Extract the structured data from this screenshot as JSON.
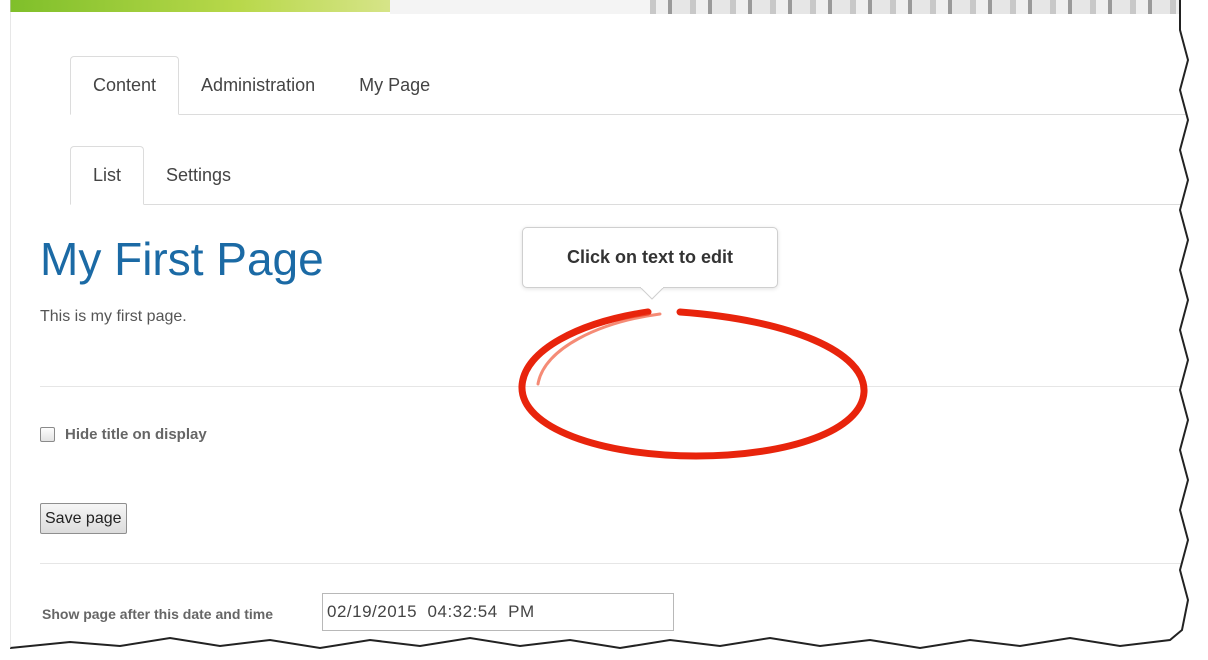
{
  "tabs_primary": [
    {
      "label": "Content",
      "active": true
    },
    {
      "label": "Administration",
      "active": false
    },
    {
      "label": "My Page",
      "active": false
    }
  ],
  "tabs_secondary": [
    {
      "label": "List",
      "active": true
    },
    {
      "label": "Settings",
      "active": false
    }
  ],
  "page": {
    "title": "My First Page",
    "description": "This is my first page."
  },
  "form": {
    "hide_title_label": "Hide title on display",
    "hide_title_checked": false,
    "save_label": "Save page",
    "date_label": "Show page after this date and time",
    "date_value": "02/19/2015  04:32:54  PM"
  },
  "annotation": {
    "tooltip_text": "Click on text to edit",
    "highlight_color": "#e8240c"
  },
  "colors": {
    "title": "#1b6aa5",
    "banner_accent": "#8cc63f"
  }
}
